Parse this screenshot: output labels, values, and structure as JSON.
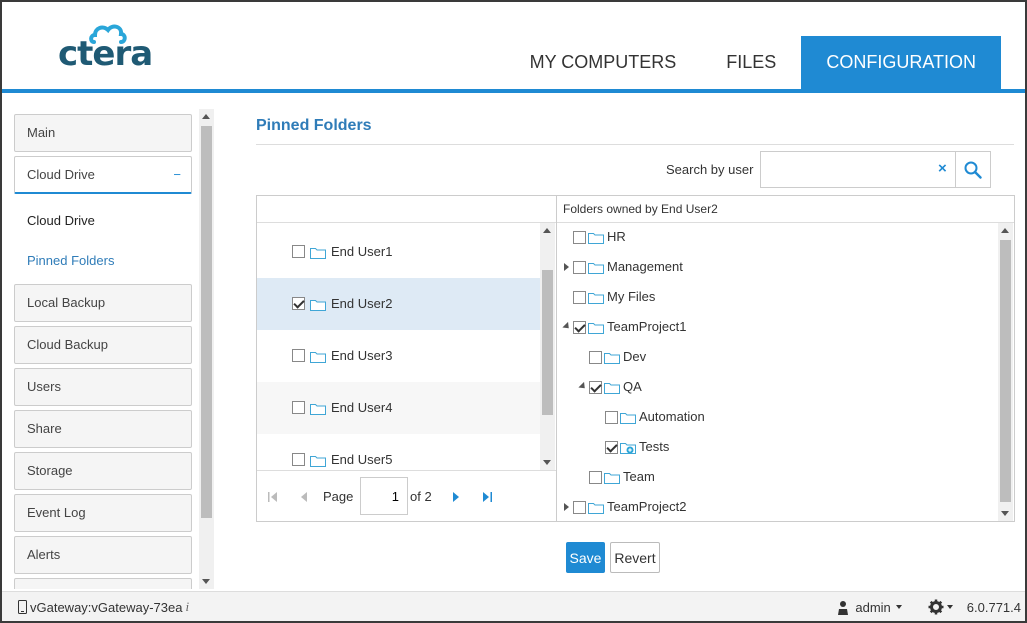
{
  "header": {
    "logo_text": "ctera",
    "tabs": [
      {
        "label": "MY COMPUTERS",
        "active": false
      },
      {
        "label": "FILES",
        "active": false
      },
      {
        "label": "CONFIGURATION",
        "active": true
      }
    ]
  },
  "sidebar": {
    "items": [
      {
        "label": "Main"
      },
      {
        "label": "Cloud Drive",
        "toggle": "−"
      },
      {
        "label": "Local Backup"
      },
      {
        "label": "Cloud Backup"
      },
      {
        "label": "Users"
      },
      {
        "label": "Share"
      },
      {
        "label": "Storage"
      },
      {
        "label": "Event Log"
      },
      {
        "label": "Alerts"
      }
    ],
    "subitems": [
      {
        "label": "Cloud Drive"
      },
      {
        "label": "Pinned Folders"
      }
    ]
  },
  "main": {
    "title": "Pinned Folders",
    "search": {
      "label": "Search by user",
      "value": "",
      "clear": "×"
    },
    "users": [
      {
        "name": "End User1",
        "checked": false
      },
      {
        "name": "End User2",
        "checked": true
      },
      {
        "name": "End User3",
        "checked": false
      },
      {
        "name": "End User4",
        "checked": false
      },
      {
        "name": "End User5",
        "checked": false
      }
    ],
    "pager": {
      "page_label": "Page",
      "page_value": "1",
      "of_label": "of 2"
    },
    "folders_header": "Folders owned by End User2",
    "folders": [
      {
        "name": "HR",
        "checked": false
      },
      {
        "name": "Management",
        "checked": false
      },
      {
        "name": "My Files",
        "checked": false
      },
      {
        "name": "TeamProject1",
        "checked": true
      },
      {
        "name": "Dev",
        "checked": false
      },
      {
        "name": "QA",
        "checked": true
      },
      {
        "name": "Automation",
        "checked": false
      },
      {
        "name": "Tests",
        "checked": true
      },
      {
        "name": "Team",
        "checked": false
      },
      {
        "name": "TeamProject2",
        "checked": false
      }
    ],
    "buttons": {
      "save": "Save",
      "revert": "Revert"
    }
  },
  "status": {
    "device": "vGateway:vGateway-73ea",
    "info_icon": "i",
    "user": "admin",
    "version": "6.0.771.4"
  },
  "colors": {
    "accent": "#1f8ad3",
    "title": "#2f7cb8",
    "logo": "#1f5a74"
  }
}
